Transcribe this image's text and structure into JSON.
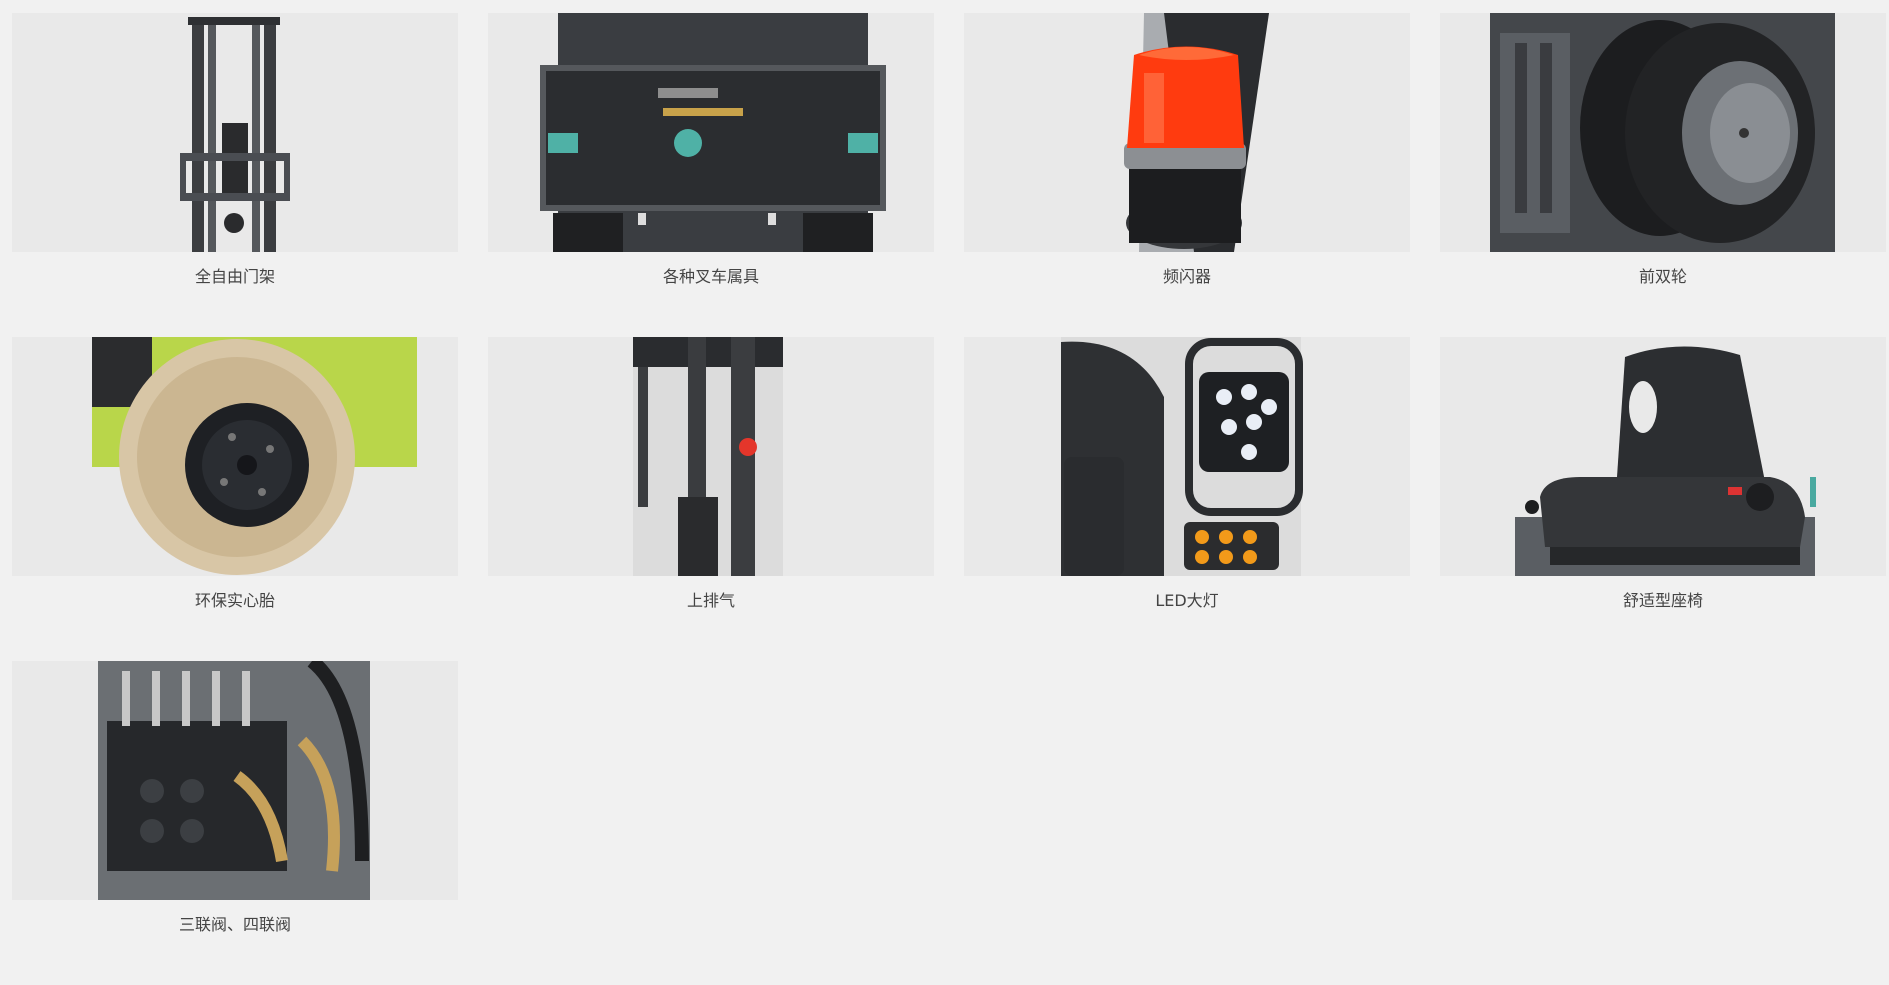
{
  "products": [
    {
      "label": "全自由门架",
      "icon": "mast-photo"
    },
    {
      "label": "各种叉车属具",
      "icon": "fork-attachment-photo"
    },
    {
      "label": "频闪器",
      "icon": "strobe-light-photo"
    },
    {
      "label": "前双轮",
      "icon": "dual-front-wheel-photo"
    },
    {
      "label": "环保实心胎",
      "icon": "solid-tire-photo"
    },
    {
      "label": "上排气",
      "icon": "upper-exhaust-photo"
    },
    {
      "label": "LED大灯",
      "icon": "led-headlight-photo"
    },
    {
      "label": "舒适型座椅",
      "icon": "comfort-seat-photo"
    },
    {
      "label": "三联阀、四联阀",
      "icon": "control-valve-photo"
    }
  ]
}
